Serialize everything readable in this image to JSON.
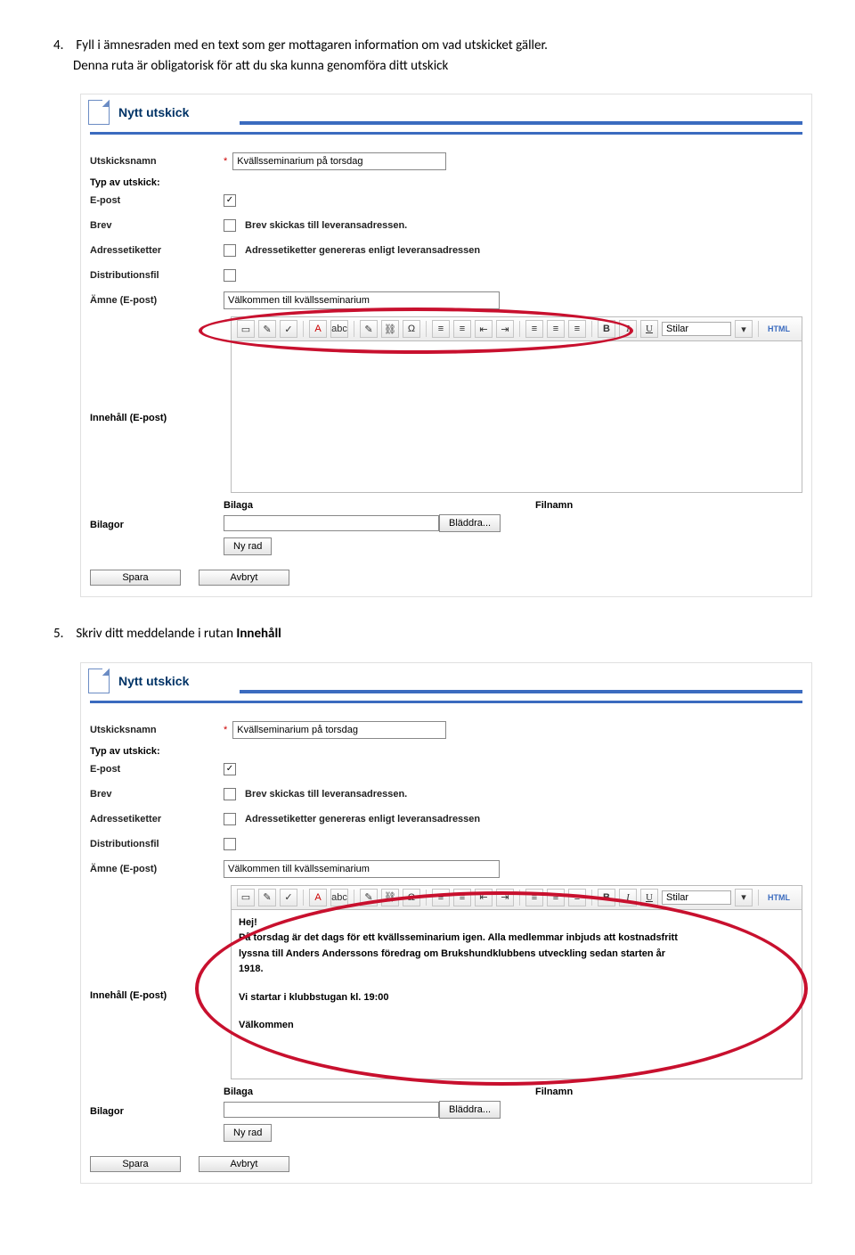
{
  "step4": {
    "num": "4.",
    "text1": "Fyll i ämnesraden med en text som ger mottagaren information om vad utskicket gäller.",
    "text2": "Denna ruta är obligatorisk för att du ska kunna genomföra ditt utskick"
  },
  "step5": {
    "num": "5.",
    "text": "Skriv ditt meddelande i rutan ",
    "bold": "Innehåll"
  },
  "ui": {
    "title": "Nytt utskick",
    "labels": {
      "utskicksnamn": "Utskicksnamn",
      "typ": "Typ av utskick:",
      "epost": "E-post",
      "brev": "Brev",
      "adr": "Adressetiketter",
      "dist": "Distributionsfil",
      "amne": "Ämne (E-post)",
      "innehall": "Innehåll (E-post)",
      "bilagor": "Bilagor",
      "bilaga": "Bilaga",
      "filnamn": "Filnamn"
    },
    "values": {
      "name1": "Kvällsseminarium på torsdag",
      "name2": "Kvällseminarium på torsdag",
      "amne": "Välkommen till kvällsseminarium",
      "brev_desc": "Brev skickas till leveransadressen.",
      "adr_desc": "Adressetiketter genereras enligt leveransadressen"
    },
    "toolbar": {
      "stilar": "Stilar",
      "html": "HTML"
    },
    "buttons": {
      "bladdra": "Bläddra...",
      "ny_rad": "Ny rad",
      "spara": "Spara",
      "avbryt": "Avbryt"
    },
    "icons": {
      "check": "✓",
      "underline_a": "A",
      "abc": "abc",
      "omega": "Ω",
      "list_n": "≡",
      "list_b": "≡",
      "outdent": "⇤",
      "indent": "⇥",
      "align_l": "≡",
      "align_c": "≡",
      "align_r": "≡",
      "bold": "B",
      "italic": "I",
      "underline": "U",
      "dropdown": "▾"
    }
  },
  "content2": {
    "l1": "Hej!",
    "l2": "På torsdag är det dags för ett kvällsseminarium igen. Alla medlemmar inbjuds att kostnadsfritt",
    "l3": "lyssna till Anders Anderssons föredrag om Brukshundklubbens utveckling sedan starten år",
    "l4": "1918.",
    "l5": "Vi startar i klubbstugan kl. 19:00",
    "l6": "Välkommen"
  }
}
